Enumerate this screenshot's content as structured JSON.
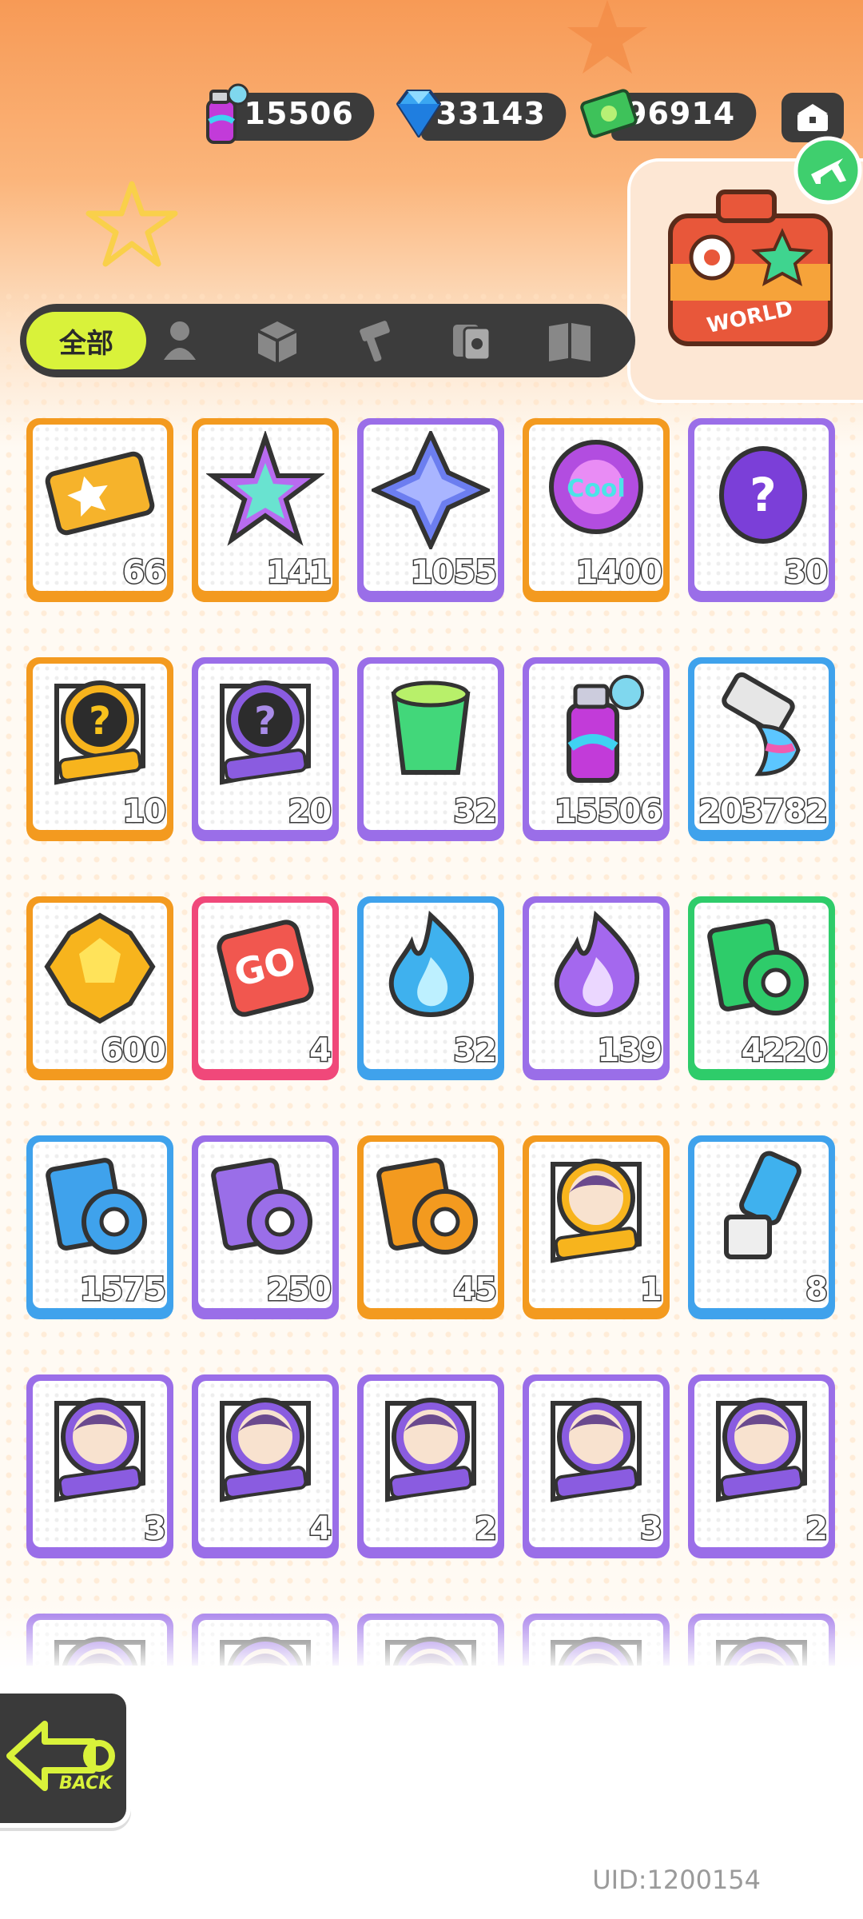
{
  "currencies": [
    {
      "name": "spray-can-icon",
      "value": "15506"
    },
    {
      "name": "diamond-icon",
      "value": "33143"
    },
    {
      "name": "cash-icon",
      "value": "496914"
    }
  ],
  "tabs": {
    "all_label": "全部",
    "icons": [
      "person-icon",
      "box-icon",
      "hammer-icon",
      "cards-icon",
      "book-icon"
    ]
  },
  "event_badge": {
    "label": "WORLD"
  },
  "items": [
    {
      "icon": "ticket-icon",
      "count": "66",
      "border": "#f39a1f"
    },
    {
      "icon": "rainbow-star-icon",
      "count": "141",
      "border": "#f39a1f"
    },
    {
      "icon": "blue-star-icon",
      "count": "1055",
      "border": "#9a6ee8"
    },
    {
      "icon": "cool-badge-icon",
      "count": "1400",
      "border": "#f39a1f"
    },
    {
      "icon": "mystery-egg-icon",
      "count": "30",
      "border": "#9a6ee8"
    },
    {
      "icon": "deity-mystery-gold-icon",
      "count": "10",
      "border": "#f39a1f"
    },
    {
      "icon": "deity-mystery-purple-icon",
      "count": "20",
      "border": "#9a6ee8"
    },
    {
      "icon": "open-cup-icon",
      "count": "32",
      "border": "#9a6ee8"
    },
    {
      "icon": "spray-can-icon",
      "count": "15506",
      "border": "#9a6ee8"
    },
    {
      "icon": "paint-tube-icon",
      "count": "203782",
      "border": "#3fa2ec"
    },
    {
      "icon": "gold-gem-icon",
      "count": "600",
      "border": "#f39a1f"
    },
    {
      "icon": "go-dice-icon",
      "count": "4",
      "border": "#f0487a"
    },
    {
      "icon": "blue-flame-icon",
      "count": "32",
      "border": "#3fa2ec"
    },
    {
      "icon": "purple-flame-icon",
      "count": "139",
      "border": "#9a6ee8"
    },
    {
      "icon": "green-tape-icon",
      "count": "4220",
      "border": "#2ecc6a"
    },
    {
      "icon": "blue-tape-icon",
      "count": "1575",
      "border": "#3fa2ec"
    },
    {
      "icon": "purple-tape-icon",
      "count": "250",
      "border": "#9a6ee8"
    },
    {
      "icon": "gold-tape-icon",
      "count": "45",
      "border": "#f39a1f"
    },
    {
      "icon": "deity-character-gold-icon",
      "count": "1",
      "border": "#f39a1f"
    },
    {
      "icon": "usb-key-icon",
      "count": "8",
      "border": "#3fa2ec"
    },
    {
      "icon": "deity-character-icon",
      "count": "3",
      "border": "#9a6ee8"
    },
    {
      "icon": "deity-character-icon",
      "count": "4",
      "border": "#9a6ee8"
    },
    {
      "icon": "deity-character-icon",
      "count": "2",
      "border": "#9a6ee8"
    },
    {
      "icon": "deity-character-icon",
      "count": "3",
      "border": "#9a6ee8"
    },
    {
      "icon": "deity-character-icon",
      "count": "2",
      "border": "#9a6ee8"
    },
    {
      "icon": "deity-character-icon",
      "count": "",
      "border": "#9a6ee8"
    },
    {
      "icon": "deity-character-icon",
      "count": "",
      "border": "#9a6ee8"
    },
    {
      "icon": "deity-character-icon",
      "count": "",
      "border": "#9a6ee8"
    },
    {
      "icon": "deity-character-icon",
      "count": "",
      "border": "#9a6ee8"
    },
    {
      "icon": "deity-character-icon",
      "count": "",
      "border": "#9a6ee8"
    }
  ],
  "back_button": {
    "label": "BACK"
  },
  "uid": "UID:1200154",
  "colors": {
    "accent": "#d9f23a",
    "dark": "#3b3b3b",
    "orange": "#f39a1f",
    "purple": "#9a6ee8",
    "blue": "#3fa2ec",
    "pink": "#f0487a",
    "green": "#2ecc6a"
  }
}
